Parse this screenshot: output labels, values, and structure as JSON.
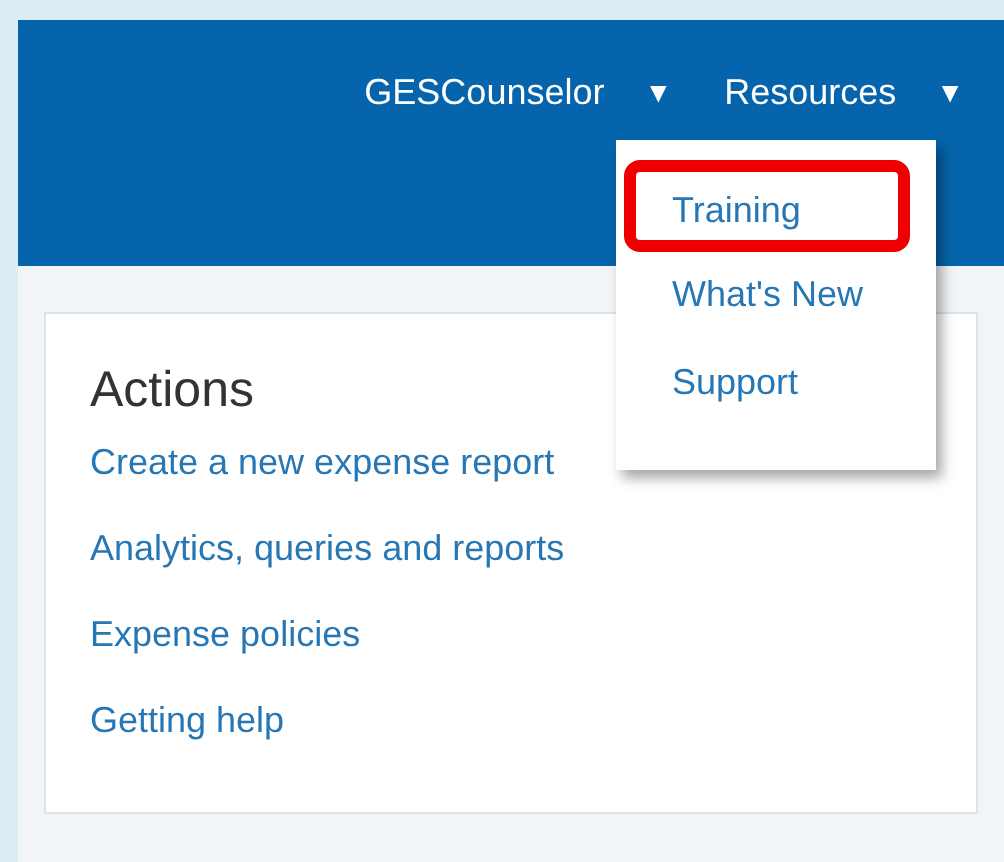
{
  "header": {
    "nav": [
      {
        "label": "GESCounselor",
        "caret": "▼"
      },
      {
        "label": "Resources",
        "caret": "▼"
      }
    ]
  },
  "resources_menu": {
    "items": [
      {
        "label": "Training",
        "highlighted": true
      },
      {
        "label": "What's New",
        "highlighted": false
      },
      {
        "label": "Support",
        "highlighted": false
      }
    ]
  },
  "actions": {
    "title": "Actions",
    "links": [
      "Create a new expense report",
      "Analytics, queries and reports",
      "Expense policies",
      "Getting help"
    ]
  }
}
